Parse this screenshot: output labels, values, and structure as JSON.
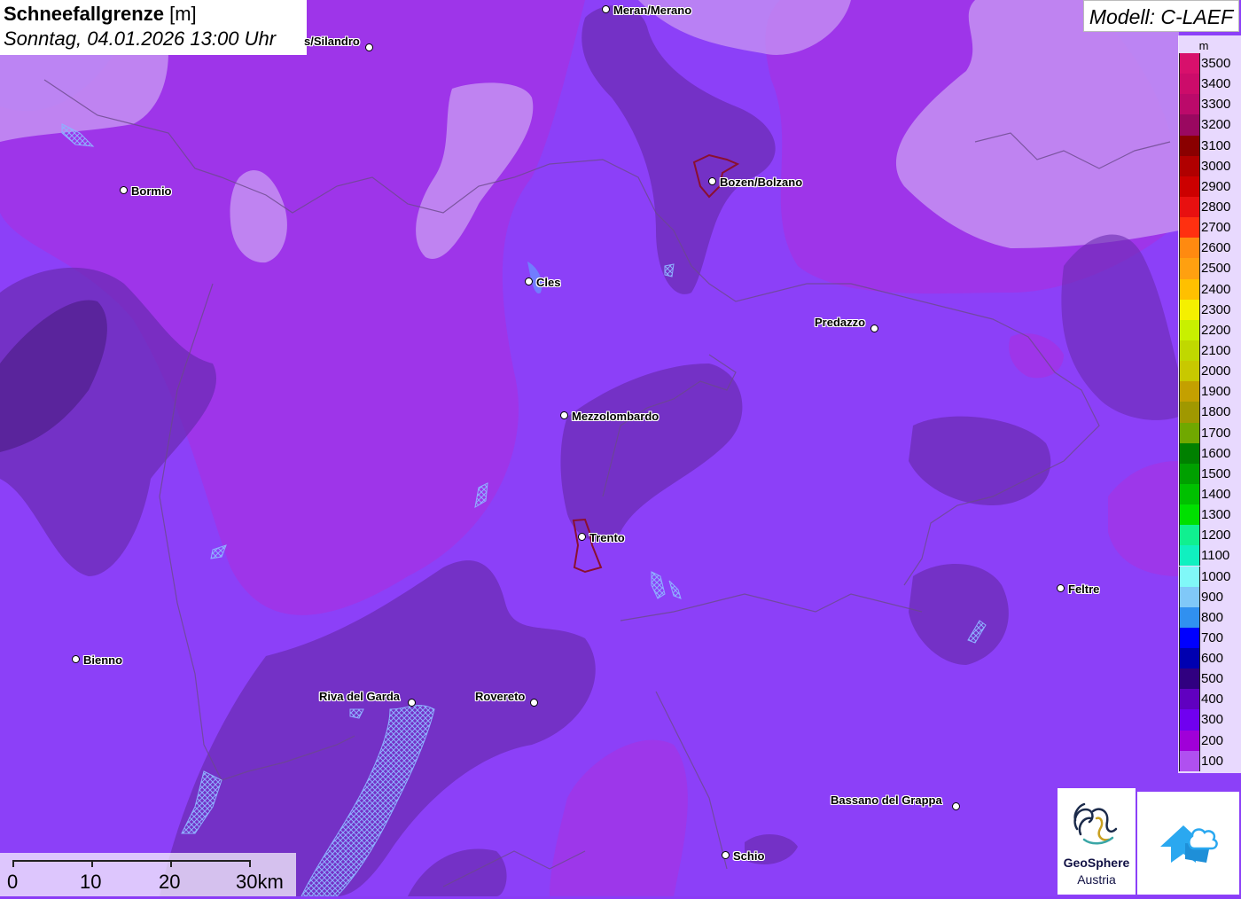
{
  "header": {
    "title_bold": "Schneefallgrenze",
    "title_unit": "[m]",
    "datetime": "Sonntag, 04.01.2026 13:00 Uhr"
  },
  "model": {
    "label": "Modell: C-LAEF"
  },
  "legend": {
    "unit": "m",
    "entries": [
      {
        "value": "3500",
        "color": "#d8106c"
      },
      {
        "value": "3400",
        "color": "#cc0c6a"
      },
      {
        "value": "3300",
        "color": "#bb0a6a"
      },
      {
        "value": "3200",
        "color": "#9a0860"
      },
      {
        "value": "3100",
        "color": "#8a0000"
      },
      {
        "value": "3000",
        "color": "#b00000"
      },
      {
        "value": "2900",
        "color": "#cc0000"
      },
      {
        "value": "2800",
        "color": "#e81010"
      },
      {
        "value": "2700",
        "color": "#ff3010"
      },
      {
        "value": "2600",
        "color": "#ff8a10"
      },
      {
        "value": "2500",
        "color": "#ffa010"
      },
      {
        "value": "2400",
        "color": "#ffc000"
      },
      {
        "value": "2300",
        "color": "#f5f000"
      },
      {
        "value": "2200",
        "color": "#c8f000"
      },
      {
        "value": "2100",
        "color": "#c0d800"
      },
      {
        "value": "2000",
        "color": "#c8c800"
      },
      {
        "value": "1900",
        "color": "#c4a000"
      },
      {
        "value": "1800",
        "color": "#a09800"
      },
      {
        "value": "1700",
        "color": "#70a800"
      },
      {
        "value": "1600",
        "color": "#008000"
      },
      {
        "value": "1500",
        "color": "#00a000"
      },
      {
        "value": "1400",
        "color": "#00c000"
      },
      {
        "value": "1300",
        "color": "#00e000"
      },
      {
        "value": "1200",
        "color": "#10f090"
      },
      {
        "value": "1100",
        "color": "#10f0c0"
      },
      {
        "value": "1000",
        "color": "#80f8f8"
      },
      {
        "value": "900",
        "color": "#80c8f8"
      },
      {
        "value": "800",
        "color": "#3090f0"
      },
      {
        "value": "700",
        "color": "#0000ff"
      },
      {
        "value": "600",
        "color": "#0000b0"
      },
      {
        "value": "500",
        "color": "#300080"
      },
      {
        "value": "400",
        "color": "#6000c0"
      },
      {
        "value": "300",
        "color": "#7000f0"
      },
      {
        "value": "200",
        "color": "#a000d8"
      },
      {
        "value": "100",
        "color": "#b050f0"
      }
    ]
  },
  "cities": [
    {
      "name": "Meran/Merano"
    },
    {
      "name": "s/Silandro"
    },
    {
      "name": "Bormio"
    },
    {
      "name": "Bozen/Bolzano"
    },
    {
      "name": "Cles"
    },
    {
      "name": "Predazzo"
    },
    {
      "name": "Mezzolombardo"
    },
    {
      "name": "Trento"
    },
    {
      "name": "Feltre"
    },
    {
      "name": "Bienno"
    },
    {
      "name": "Riva del Garda"
    },
    {
      "name": "Rovereto"
    },
    {
      "name": "Bassano del Grappa"
    },
    {
      "name": "Schio"
    }
  ],
  "scale_bar": {
    "labels": [
      "0",
      "10",
      "20",
      "30km"
    ]
  },
  "logos": {
    "geosphere_name": "GeoSphere",
    "geosphere_sub": "Austria"
  }
}
